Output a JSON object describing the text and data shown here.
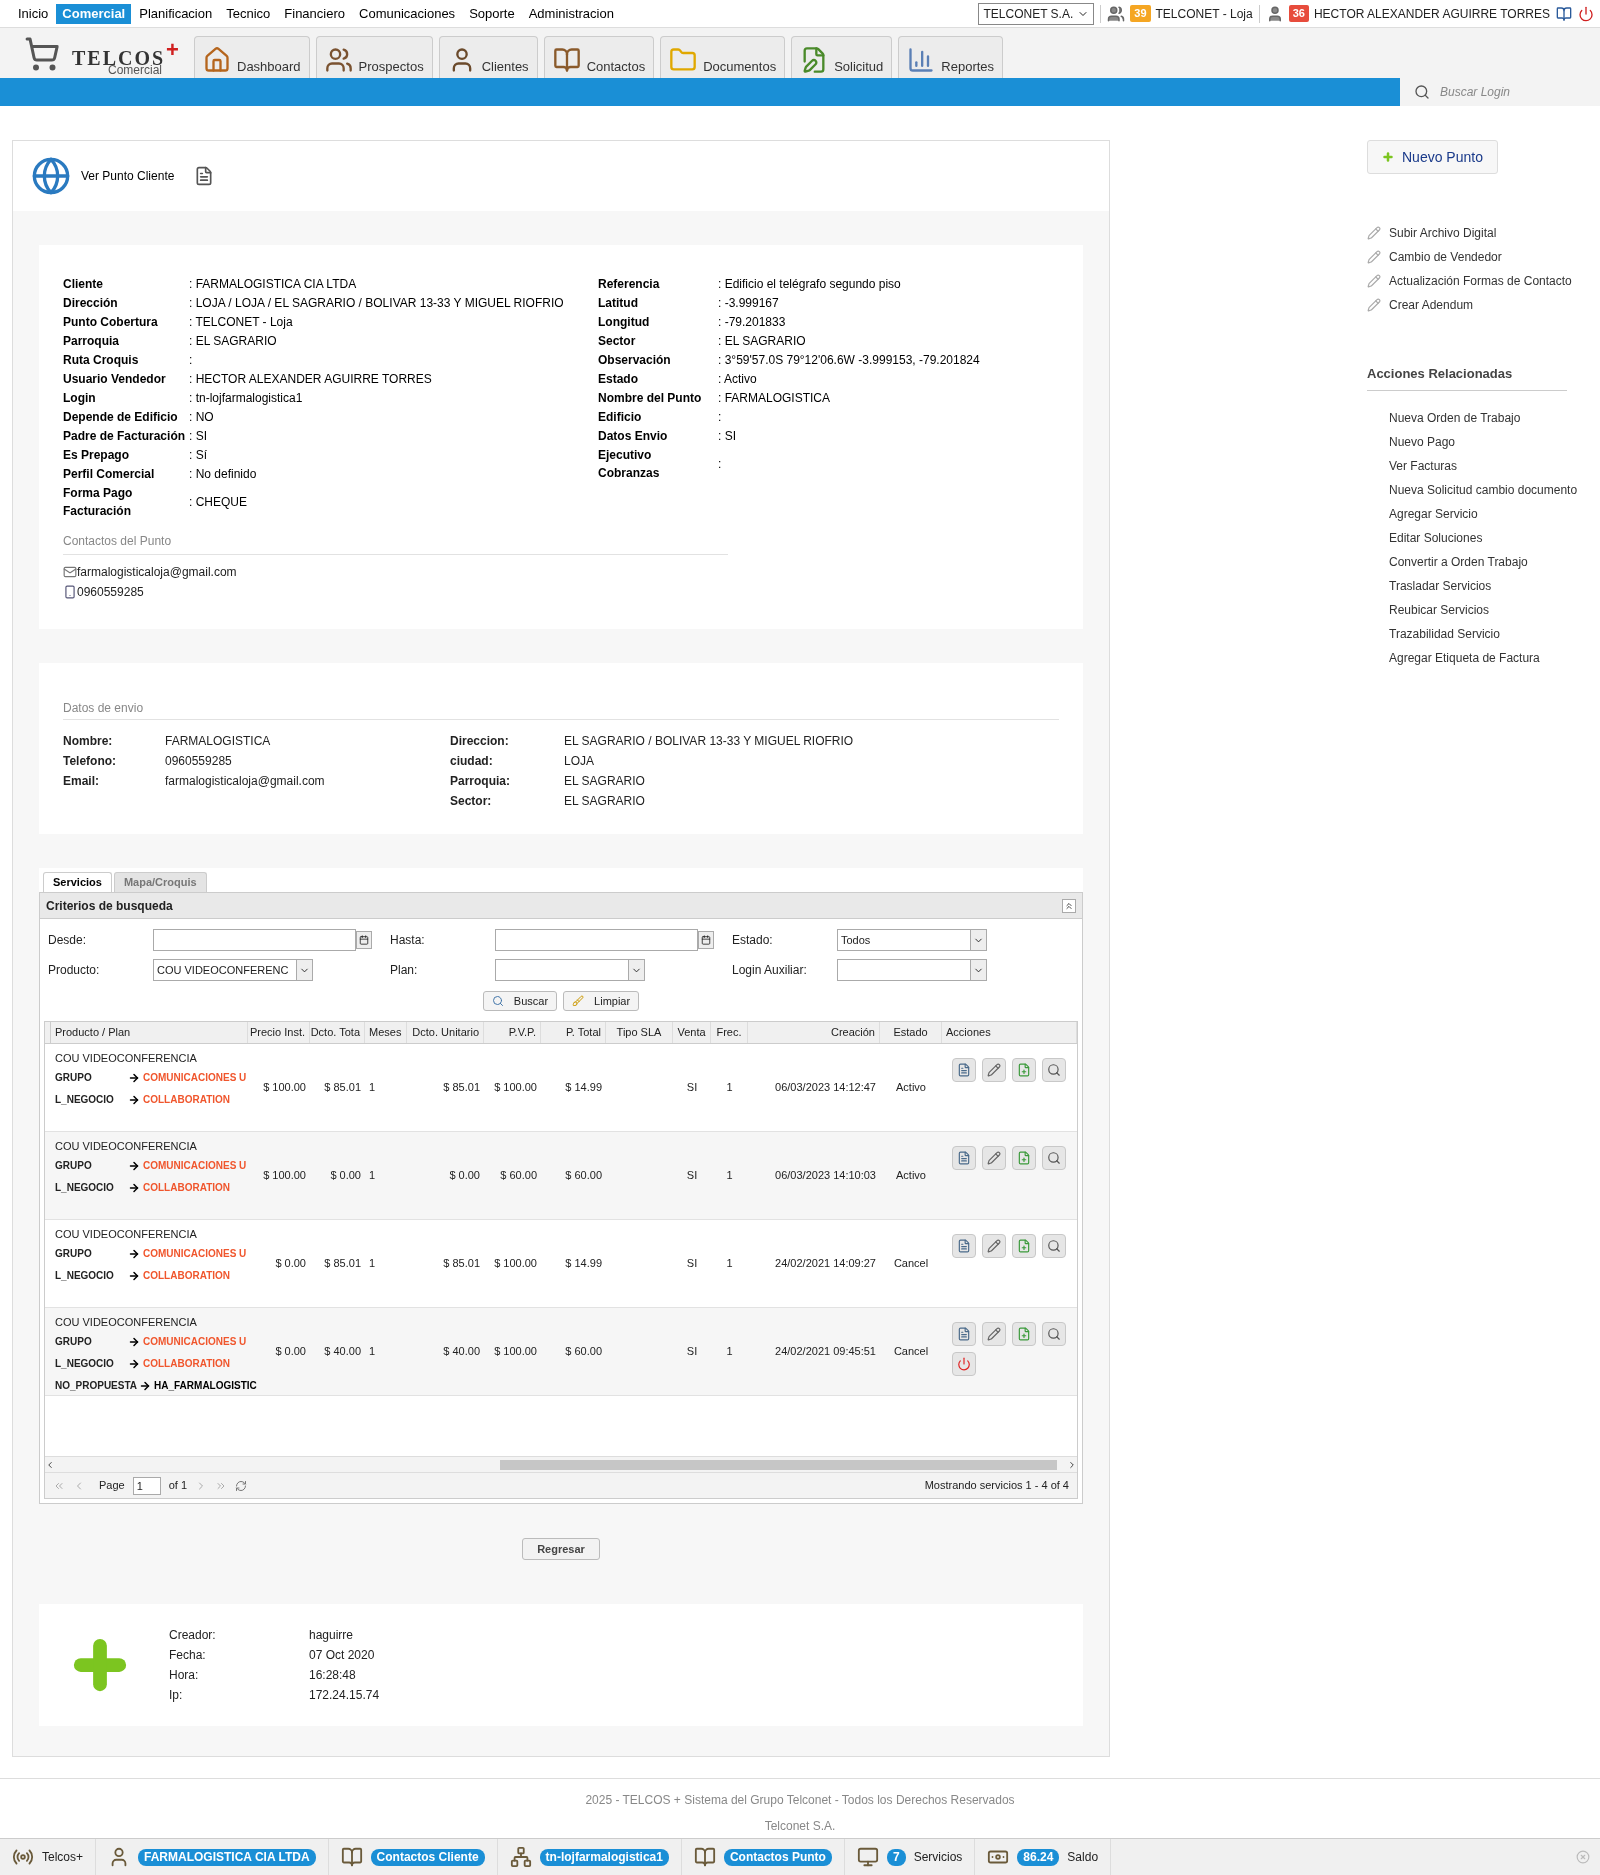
{
  "top_menu": [
    {
      "label": "Inicio",
      "selected": false
    },
    {
      "label": "Comercial",
      "selected": true
    },
    {
      "label": "Planificacion",
      "selected": false
    },
    {
      "label": "Tecnico",
      "selected": false
    },
    {
      "label": "Financiero",
      "selected": false
    },
    {
      "label": "Comunicaciones",
      "selected": false
    },
    {
      "label": "Soporte",
      "selected": false
    },
    {
      "label": "Administracion",
      "selected": false
    }
  ],
  "company_select": "TELCONET S.A.",
  "notifications": [
    {
      "kind": "group",
      "count": "39",
      "label": "TELCONET - Loja",
      "color": "#f5a623"
    },
    {
      "kind": "user",
      "count": "36",
      "label": "HECTOR ALEXANDER AGUIRRE TORRES",
      "color": "#e74c3c"
    }
  ],
  "logo": {
    "text": "TELCOS",
    "mark": "+",
    "subtitle": "Comercial"
  },
  "modules": [
    {
      "label": "Dashboard",
      "kind": "home"
    },
    {
      "label": "Prospectos",
      "kind": "people"
    },
    {
      "label": "Clientes",
      "kind": "person"
    },
    {
      "label": "Contactos",
      "kind": "book"
    },
    {
      "label": "Documentos",
      "kind": "folder"
    },
    {
      "label": "Solicitud",
      "kind": "form"
    },
    {
      "label": "Reportes",
      "kind": "chart"
    }
  ],
  "search_login": {
    "placeholder": "Buscar Login"
  },
  "page_title": "Ver Punto Cliente",
  "client_left": [
    {
      "label": "Cliente",
      "value": ": FARMALOGISTICA CIA LTDA"
    },
    {
      "label": "Dirección",
      "value": ": LOJA / LOJA / EL SAGRARIO / BOLIVAR 13-33 Y MIGUEL RIOFRIO"
    },
    {
      "label": "Punto Cobertura",
      "value": ": TELCONET - Loja"
    },
    {
      "label": "Parroquia",
      "value": ": EL SAGRARIO"
    },
    {
      "label": "Ruta Croquis",
      "value": ":"
    },
    {
      "label": "Usuario Vendedor",
      "value": ": HECTOR ALEXANDER AGUIRRE TORRES"
    },
    {
      "label": "Login",
      "value": ": tn-lojfarmalogistica1"
    },
    {
      "label": "Depende de Edificio",
      "value": ": NO"
    },
    {
      "label": "Padre de Facturación",
      "value": ": SI"
    },
    {
      "label": "Es Prepago",
      "value": ": Sí"
    },
    {
      "label": "Perfil Comercial",
      "value": ": No definido"
    },
    {
      "label": "Forma Pago Facturación",
      "value": ": CHEQUE"
    }
  ],
  "client_right": [
    {
      "label": "Referencia",
      "value": ": Edificio el telégrafo segundo piso"
    },
    {
      "label": "Latitud",
      "value": ": -3.999167"
    },
    {
      "label": "Longitud",
      "value": ": -79.201833"
    },
    {
      "label": "Sector",
      "value": ": EL SAGRARIO"
    },
    {
      "label": "Observación",
      "value": ": 3°59'57.0S 79°12'06.6W -3.999153, -79.201824"
    },
    {
      "label": "Estado",
      "value": ": Activo"
    },
    {
      "label": "Nombre del Punto",
      "value": ": FARMALOGISTICA"
    },
    {
      "label": "Edificio",
      "value": ":"
    },
    {
      "label": "Datos Envio",
      "value": ": SI"
    },
    {
      "label": "Ejecutivo Cobranzas",
      "value": ":"
    }
  ],
  "contacts": {
    "title": "Contactos del Punto",
    "items": [
      {
        "kind": "email",
        "value": "farmalogisticaloja@gmail.com"
      },
      {
        "kind": "phone",
        "value": "0960559285"
      }
    ]
  },
  "shipping": {
    "title": "Datos de envio",
    "left": [
      {
        "label": "Nombre:",
        "value": "FARMALOGISTICA"
      },
      {
        "label": "Telefono:",
        "value": "0960559285"
      },
      {
        "label": "Email:",
        "value": "farmalogisticaloja@gmail.com"
      }
    ],
    "right": [
      {
        "label": "Direccion:",
        "value": "EL SAGRARIO / BOLIVAR 13-33 Y MIGUEL RIOFRIO"
      },
      {
        "label": "ciudad:",
        "value": "LOJA"
      },
      {
        "label": "Parroquia:",
        "value": "EL SAGRARIO"
      },
      {
        "label": "Sector:",
        "value": "EL SAGRARIO"
      }
    ]
  },
  "tabs": [
    {
      "label": "Servicios",
      "selected": true
    },
    {
      "label": "Mapa/Croquis",
      "selected": false
    }
  ],
  "filter": {
    "title": "Criterios de busqueda",
    "fields": [
      {
        "label": "Desde:",
        "kind": "date"
      },
      {
        "label": "Hasta:",
        "kind": "date"
      },
      {
        "label": "Estado:",
        "kind": "select",
        "value": "Todos"
      },
      {
        "label": "Producto:",
        "kind": "select",
        "value": "COU VIDEOCONFERENC"
      },
      {
        "label": "Plan:",
        "kind": "select"
      },
      {
        "label": "Login Auxiliar:",
        "kind": "select"
      }
    ],
    "buttons": [
      {
        "label": "Buscar",
        "kind": "search"
      },
      {
        "label": "Limpiar",
        "kind": "clear"
      }
    ]
  },
  "table": {
    "product_header": "Producto / Plan",
    "columns": [
      "Precio Inst.",
      "Dcto. Tota",
      "Meses",
      "Dcto. Unitario",
      "P.V.P.",
      "P. Total",
      "Tipo SLA",
      "Venta",
      "Frec.",
      "Creación",
      "Estado"
    ],
    "actions_header": "Acciones",
    "rows": [
      {
        "product": "COU VIDEOCONFERENCIA",
        "attributes": [
          {
            "key": "GRUPO",
            "value": "COMUNICACIONES U",
            "color": "#f0562d"
          },
          {
            "key": "L_NEGOCIO",
            "value": "COLLABORATION",
            "color": "#f0562d"
          }
        ],
        "cells": [
          "$ 100.00",
          "$ 85.01",
          "1",
          "$ 85.01",
          "$ 100.00",
          "$ 14.99",
          "",
          "SI",
          "1",
          "06/03/2023 14:12:47",
          "Activo"
        ],
        "actions": [
          {
            "kind": "detail"
          },
          {
            "kind": "edit"
          },
          {
            "kind": "add"
          },
          {
            "kind": "search"
          }
        ]
      },
      {
        "product": "COU VIDEOCONFERENCIA",
        "attributes": [
          {
            "key": "GRUPO",
            "value": "COMUNICACIONES U",
            "color": "#f0562d"
          },
          {
            "key": "L_NEGOCIO",
            "value": "COLLABORATION",
            "color": "#f0562d"
          }
        ],
        "cells": [
          "$ 100.00",
          "$ 0.00",
          "1",
          "$ 0.00",
          "$ 60.00",
          "$ 60.00",
          "",
          "SI",
          "1",
          "06/03/2023 14:10:03",
          "Activo"
        ],
        "actions": [
          {
            "kind": "detail"
          },
          {
            "kind": "edit"
          },
          {
            "kind": "add"
          },
          {
            "kind": "search"
          }
        ]
      },
      {
        "product": "COU VIDEOCONFERENCIA",
        "attributes": [
          {
            "key": "GRUPO",
            "value": "COMUNICACIONES U",
            "color": "#f0562d"
          },
          {
            "key": "L_NEGOCIO",
            "value": "COLLABORATION",
            "color": "#f0562d"
          }
        ],
        "cells": [
          "$ 0.00",
          "$ 85.01",
          "1",
          "$ 85.01",
          "$ 100.00",
          "$ 14.99",
          "",
          "SI",
          "1",
          "24/02/2021 14:09:27",
          "Cancel"
        ],
        "actions": [
          {
            "kind": "detail"
          },
          {
            "kind": "edit"
          },
          {
            "kind": "add"
          },
          {
            "kind": "search"
          }
        ]
      },
      {
        "product": "COU VIDEOCONFERENCIA",
        "attributes": [
          {
            "key": "GRUPO",
            "value": "COMUNICACIONES U",
            "color": "#f0562d"
          },
          {
            "key": "L_NEGOCIO",
            "value": "COLLABORATION",
            "color": "#f0562d"
          },
          {
            "key": "NO_PROPUESTA",
            "value": "HA_FARMALOGISTIC",
            "color": "#000000"
          }
        ],
        "cells": [
          "$ 0.00",
          "$ 40.00",
          "1",
          "$ 40.00",
          "$ 100.00",
          "$ 60.00",
          "",
          "SI",
          "1",
          "24/02/2021 09:45:51",
          "Cancel"
        ],
        "actions": [
          {
            "kind": "detail"
          },
          {
            "kind": "edit"
          },
          {
            "kind": "add"
          },
          {
            "kind": "search"
          },
          {
            "kind": "power"
          }
        ]
      }
    ]
  },
  "pager": {
    "page_label": "Page",
    "page": "1",
    "of": "of 1",
    "summary": "Mostrando servicios 1 - 4 of 4"
  },
  "back_button": "Regresar",
  "audit": [
    {
      "label": "Creador:",
      "value": "haguirre"
    },
    {
      "label": "Fecha:",
      "value": "07 Oct 2020"
    },
    {
      "label": "Hora:",
      "value": "16:28:48"
    },
    {
      "label": "Ip:",
      "value": "172.24.15.74"
    }
  ],
  "sidebar": {
    "new_button": "Nuevo Punto",
    "quick_actions": [
      "Subir Archivo Digital",
      "Cambio de Vendedor",
      "Actualización Formas de Contacto",
      "Crear Adendum"
    ],
    "related_title": "Acciones Relacionadas",
    "related": [
      "Nueva Orden de Trabajo",
      "Nuevo Pago",
      "Ver Facturas",
      "Nueva Solicitud cambio documento",
      "Agregar Servicio",
      "Editar Soluciones",
      "Convertir a Orden Trabajo",
      "Trasladar Servicios",
      "Reubicar Servicios",
      "Trazabilidad Servicio",
      "Agregar Etiqueta de Factura"
    ]
  },
  "footer": [
    "2025 - TELCOS + Sistema del Grupo Telconet - Todos los Derechos Reservados",
    "Telconet S.A."
  ],
  "taskbar": [
    {
      "kind": "app",
      "label": "Telcos+"
    },
    {
      "kind": "client",
      "badge": "FARMALOGISTICA CIA LTDA"
    },
    {
      "kind": "contacts",
      "badge": "Contactos Cliente"
    },
    {
      "kind": "login",
      "badge": "tn-lojfarmalogistica1"
    },
    {
      "kind": "contacts",
      "badge": "Contactos Punto"
    },
    {
      "kind": "services",
      "badge": "7",
      "label": "Servicios"
    },
    {
      "kind": "money",
      "badge": "86.24",
      "label": "Saldo"
    }
  ]
}
